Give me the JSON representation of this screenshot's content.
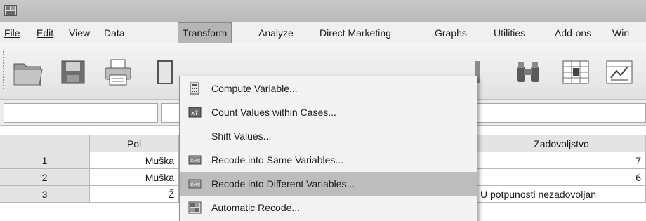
{
  "titlebar": {
    "icon": "spss-app-icon"
  },
  "menubar": {
    "items": [
      {
        "label": "File"
      },
      {
        "label": "Edit"
      },
      {
        "label": "View"
      },
      {
        "label": "Data"
      },
      {
        "label": "Transform"
      },
      {
        "label": "Analyze"
      },
      {
        "label": "Direct Marketing"
      },
      {
        "label": "Graphs"
      },
      {
        "label": "Utilities"
      },
      {
        "label": "Add-ons"
      },
      {
        "label": "Win"
      }
    ],
    "active": "Transform"
  },
  "toolbar": {
    "icons": [
      "open-folder-icon",
      "save-icon",
      "print-icon",
      "dialog-recall-icon",
      "find-icon",
      "split-file-icon",
      "weight-cases-icon"
    ]
  },
  "table": {
    "headers": [
      "",
      "Pol",
      "Zadovoljstvo"
    ],
    "rows": [
      {
        "num": "1",
        "pol": "Muška",
        "zad": "7"
      },
      {
        "num": "2",
        "pol": "Muška",
        "zad": "6"
      },
      {
        "num": "3",
        "pol": "Ž",
        "zad": "U potpunosti nezadovoljan"
      }
    ]
  },
  "transform_menu": {
    "items": [
      {
        "label": "Compute Variable...",
        "icon": "calculator-icon"
      },
      {
        "label": "Count Values within Cases...",
        "icon": "count-values-icon"
      },
      {
        "label": "Shift Values...",
        "icon": ""
      },
      {
        "label": "Recode into Same Variables...",
        "icon": "recode-same-icon"
      },
      {
        "label": "Recode into Different Variables...",
        "icon": "recode-different-icon",
        "highlighted": true
      },
      {
        "label": "Automatic Recode...",
        "icon": "automatic-recode-icon"
      }
    ]
  }
}
